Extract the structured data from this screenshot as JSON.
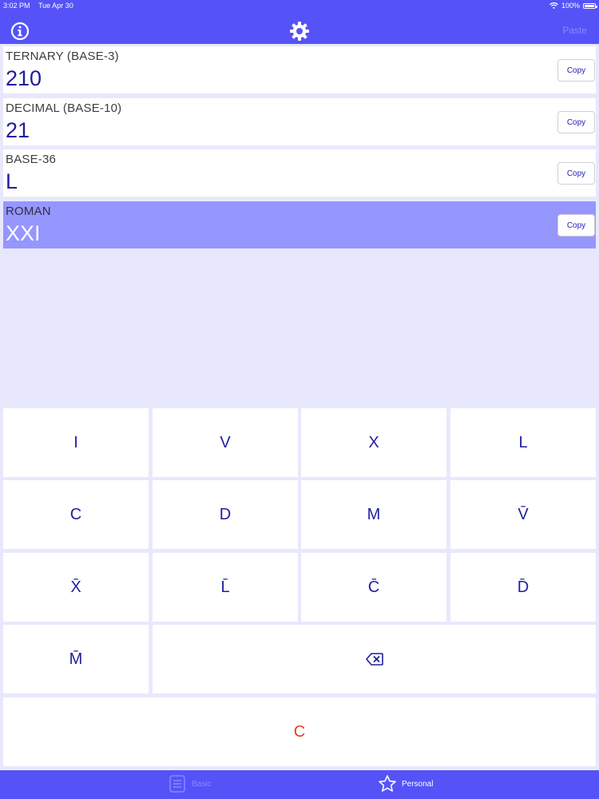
{
  "status": {
    "time": "3:02 PM",
    "date": "Tue Apr 30",
    "battery_text": "100%"
  },
  "nav": {
    "info_icon": "info-circle-icon",
    "settings_icon": "gear-icon",
    "paste_label": "Paste"
  },
  "cards": [
    {
      "label": "TERNARY (BASE-3)",
      "value": "210",
      "copy_label": "Copy",
      "selected": false
    },
    {
      "label": "DECIMAL (BASE-10)",
      "value": "21",
      "copy_label": "Copy",
      "selected": false
    },
    {
      "label": "BASE-36",
      "value": "L",
      "copy_label": "Copy",
      "selected": false
    },
    {
      "label": "ROMAN",
      "value": "XXI",
      "copy_label": "Copy",
      "selected": true
    }
  ],
  "keypad": {
    "keys": [
      "I",
      "V",
      "X",
      "L",
      "C",
      "D",
      "M",
      "V̄",
      "X̄",
      "L̄",
      "C̄",
      "D̄",
      "M̄"
    ],
    "backspace_icon": "backspace-icon",
    "clear_label": "C"
  },
  "tabs": [
    {
      "label": "Basic",
      "icon": "calculator-list-icon",
      "active": false
    },
    {
      "label": "Personal",
      "icon": "star-icon",
      "active": true
    }
  ],
  "colors": {
    "bar": "#5553f7",
    "background": "#e8e8fd",
    "selected_card": "#9696ff",
    "key_text": "#1e1ea0",
    "clear_text": "#e8401c"
  }
}
